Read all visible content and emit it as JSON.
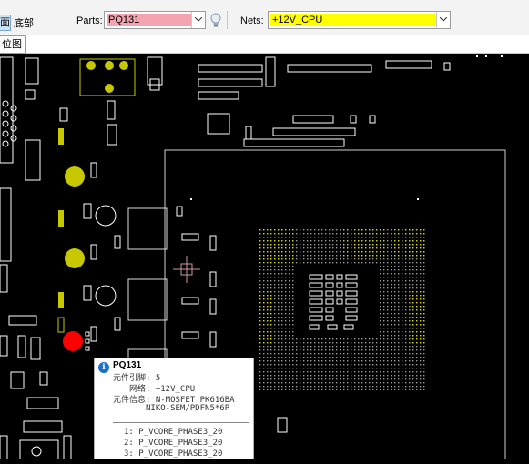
{
  "toolbar": {
    "top_label": "面",
    "bottom_tab": "底部",
    "parts_label": "Parts:",
    "parts_value": "PQ131",
    "nets_label": "Nets:",
    "nets_value": "+12V_CPU",
    "parts_highlight": "#f4a3b0",
    "nets_highlight": "#ffff00"
  },
  "subtab": {
    "label": "位图"
  },
  "board": {
    "background": "#000000",
    "trace_color": "#ffffff",
    "highlight_part_color": "#ff0000",
    "highlight_net_color": "#c8c800"
  },
  "tooltip": {
    "icon": "info-icon",
    "title": "PQ131",
    "pin_count_label": "元件引脚: 5",
    "net_label": "网络: +12V_CPU",
    "info_label": "元件信息: N-MOSFET PK616BA",
    "info_line2": "NIKO-SEM/PDFN5*6P",
    "pins": [
      "1: P_VCORE_PHASE3_20",
      "2: P_VCORE_PHASE3_20",
      "3: P_VCORE_PHASE3_20"
    ]
  }
}
